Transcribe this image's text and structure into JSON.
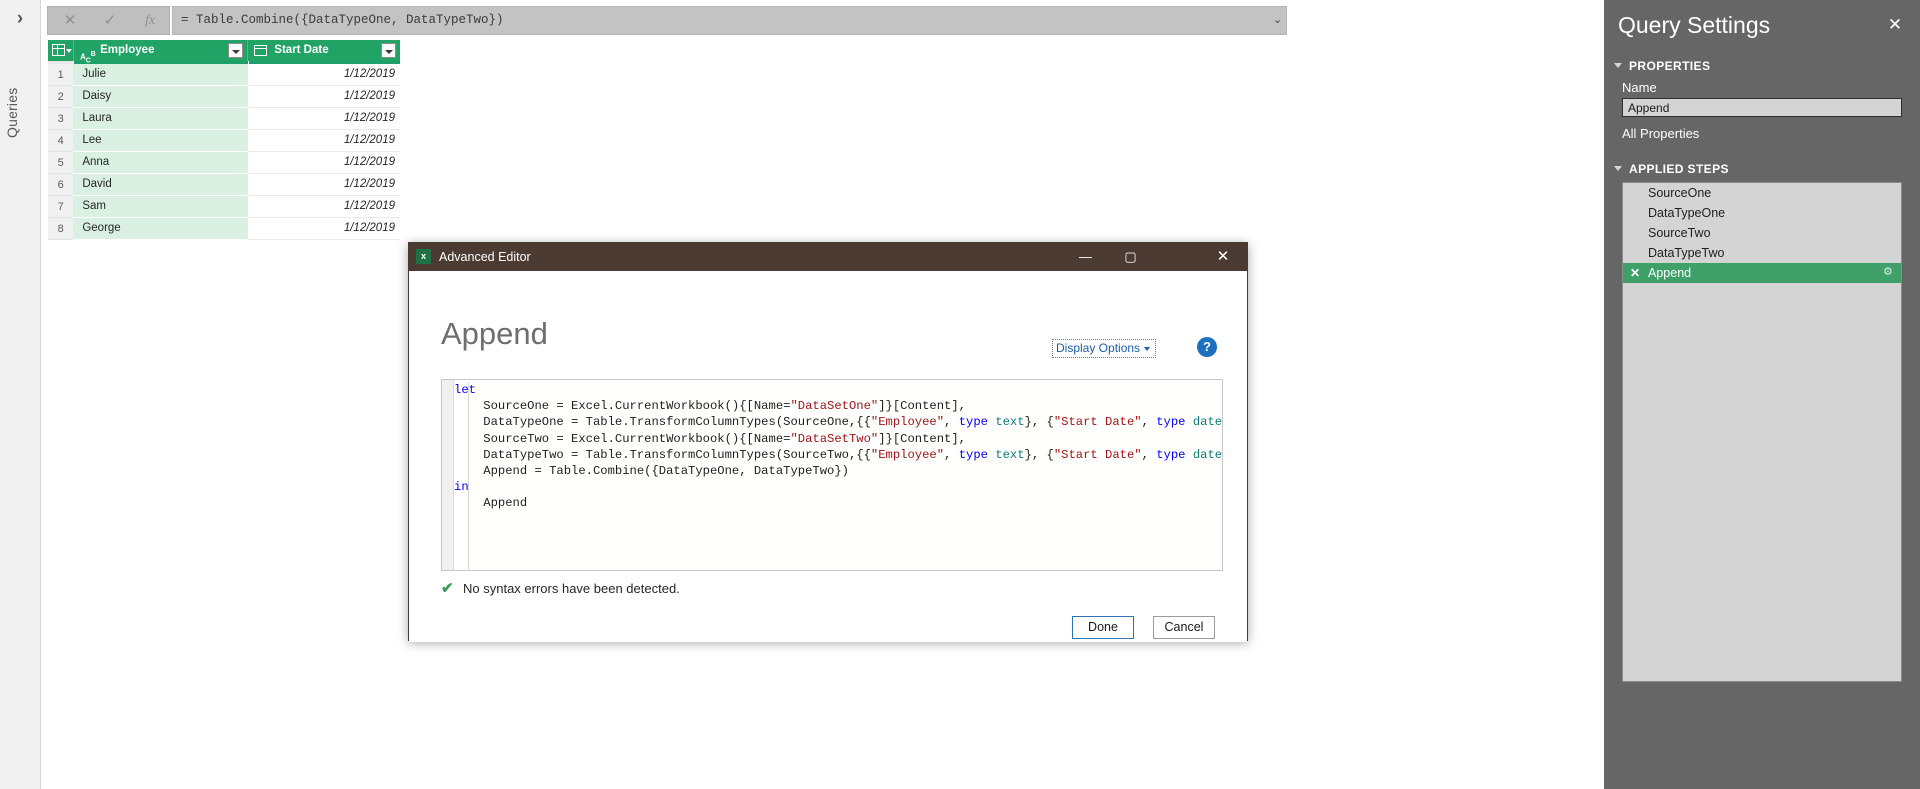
{
  "left_rail": {
    "expand_icon": "›",
    "label": "Queries"
  },
  "formula_bar": {
    "cancel_icon": "✕",
    "accept_icon": "✓",
    "fx_icon": "fx",
    "value": "= Table.Combine({DataTypeOne, DataTypeTwo})",
    "expand_icon": "⌄"
  },
  "grid": {
    "columns": [
      {
        "name": "Employee",
        "type_icon": "abc-text-type-icon"
      },
      {
        "name": "Start Date",
        "type_icon": "calendar-date-type-icon"
      }
    ],
    "rows": [
      {
        "num": "1",
        "employee": "Julie",
        "start_date": "1/12/2019"
      },
      {
        "num": "2",
        "employee": "Daisy",
        "start_date": "1/12/2019"
      },
      {
        "num": "3",
        "employee": "Laura",
        "start_date": "1/12/2019"
      },
      {
        "num": "4",
        "employee": "Lee",
        "start_date": "1/12/2019"
      },
      {
        "num": "5",
        "employee": "Anna",
        "start_date": "1/12/2019"
      },
      {
        "num": "6",
        "employee": "David",
        "start_date": "1/12/2019"
      },
      {
        "num": "7",
        "employee": "Sam",
        "start_date": "1/12/2019"
      },
      {
        "num": "8",
        "employee": "George",
        "start_date": "1/12/2019"
      }
    ]
  },
  "query_settings": {
    "title": "Query Settings",
    "close_icon": "✕",
    "properties_header": "PROPERTIES",
    "name_label": "Name",
    "name_value": "Append",
    "all_properties_link": "All Properties",
    "applied_steps_header": "APPLIED STEPS",
    "steps": [
      {
        "label": "SourceOne",
        "selected": false
      },
      {
        "label": "DataTypeOne",
        "selected": false
      },
      {
        "label": "SourceTwo",
        "selected": false
      },
      {
        "label": "DataTypeTwo",
        "selected": false
      },
      {
        "label": "Append",
        "selected": true,
        "delete_icon": "✕",
        "gear_icon": "⚙"
      }
    ]
  },
  "dialog": {
    "title": "Advanced Editor",
    "app_icon": "x",
    "minimize_icon": "—",
    "maximize_icon": "▢",
    "close_icon": "✕",
    "heading": "Append",
    "display_options_label": "Display Options",
    "help_icon": "?",
    "code_lines": [
      {
        "indent": 0,
        "tokens": [
          {
            "t": "let",
            "c": "kw"
          }
        ]
      },
      {
        "indent": 1,
        "tokens": [
          {
            "t": "SourceOne = Excel.CurrentWorkbook(){[Name=",
            "c": ""
          },
          {
            "t": "\"DataSetOne\"",
            "c": "str"
          },
          {
            "t": "]}[Content],",
            "c": ""
          }
        ]
      },
      {
        "indent": 1,
        "tokens": [
          {
            "t": "DataTypeOne = Table.TransformColumnTypes(SourceOne,{{",
            "c": ""
          },
          {
            "t": "\"Employee\"",
            "c": "str"
          },
          {
            "t": ", ",
            "c": ""
          },
          {
            "t": "type",
            "c": "typ"
          },
          {
            "t": " ",
            "c": ""
          },
          {
            "t": "text",
            "c": "typ2"
          },
          {
            "t": "}, {",
            "c": ""
          },
          {
            "t": "\"Start Date\"",
            "c": "str"
          },
          {
            "t": ", ",
            "c": ""
          },
          {
            "t": "type",
            "c": "typ"
          },
          {
            "t": " ",
            "c": ""
          },
          {
            "t": "date",
            "c": "typ2"
          },
          {
            "t": "}}),",
            "c": ""
          }
        ]
      },
      {
        "indent": 1,
        "tokens": [
          {
            "t": "SourceTwo = Excel.CurrentWorkbook(){[Name=",
            "c": ""
          },
          {
            "t": "\"DataSetTwo\"",
            "c": "str"
          },
          {
            "t": "]}[Content],",
            "c": ""
          }
        ]
      },
      {
        "indent": 1,
        "tokens": [
          {
            "t": "DataTypeTwo = Table.TransformColumnTypes(SourceTwo,{{",
            "c": ""
          },
          {
            "t": "\"Employee\"",
            "c": "str"
          },
          {
            "t": ", ",
            "c": ""
          },
          {
            "t": "type",
            "c": "typ"
          },
          {
            "t": " ",
            "c": ""
          },
          {
            "t": "text",
            "c": "typ2"
          },
          {
            "t": "}, {",
            "c": ""
          },
          {
            "t": "\"Start Date\"",
            "c": "str"
          },
          {
            "t": ", ",
            "c": ""
          },
          {
            "t": "type",
            "c": "typ"
          },
          {
            "t": " ",
            "c": ""
          },
          {
            "t": "date",
            "c": "typ2"
          },
          {
            "t": "}}),",
            "c": ""
          }
        ]
      },
      {
        "indent": 1,
        "tokens": [
          {
            "t": "Append = Table.Combine({DataTypeOne, DataTypeTwo})",
            "c": ""
          }
        ]
      },
      {
        "indent": 0,
        "tokens": [
          {
            "t": "in",
            "c": "kw"
          }
        ]
      },
      {
        "indent": 1,
        "tokens": [
          {
            "t": "Append",
            "c": ""
          }
        ]
      }
    ],
    "status_icon": "✔",
    "status_text": "No syntax errors have been detected.",
    "done_label": "Done",
    "cancel_label": "Cancel"
  },
  "colors": {
    "grid_header_green": "#21a366",
    "selected_step_green": "#3fa06a",
    "dialog_titlebar": "#4c3b33",
    "settings_pane": "#666666",
    "string_literal": "#a31515",
    "keyword_blue": "#0000ff",
    "type_teal": "#0f7b7b"
  }
}
